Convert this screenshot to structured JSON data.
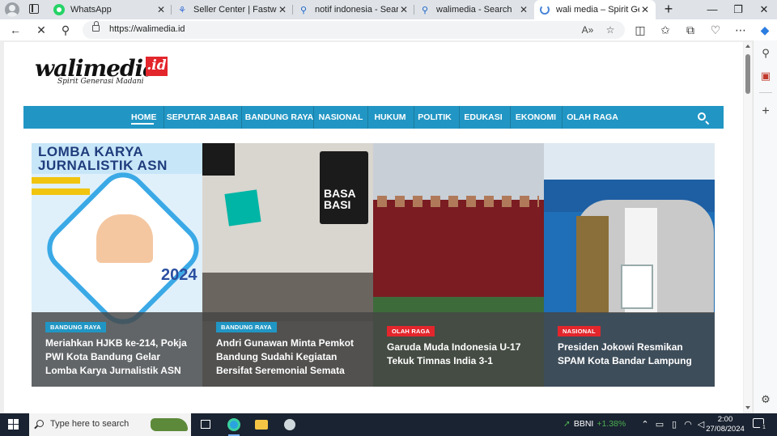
{
  "browser": {
    "tabs": [
      {
        "title": "WhatsApp",
        "icon": "whatsapp-icon",
        "close": "✕"
      },
      {
        "title": "Seller Center | Fastwork.id",
        "icon": "fastwork-icon",
        "close": "✕"
      },
      {
        "title": "notif indonesia - Search",
        "icon": "search-icon",
        "close": "✕"
      },
      {
        "title": "walimedia - Search",
        "icon": "search-icon",
        "close": "✕"
      },
      {
        "title": "wali media – Spirit Generasi Madani",
        "icon": "loading-spinner-icon",
        "close": "✕",
        "active": true
      }
    ],
    "new_tab": "+",
    "window_controls": {
      "minimize": "—",
      "maximize": "❐",
      "close": "✕"
    },
    "address_bar": {
      "url": "https://walimedia.id"
    },
    "toolbar_icons": [
      "back-icon",
      "stop-loading-icon",
      "search-icon",
      "read-aloud-icon",
      "favorite-star-icon",
      "split-screen-icon",
      "favorites-icon",
      "collections-icon",
      "browser-essentials-icon",
      "more-icon",
      "copilot-icon"
    ]
  },
  "site": {
    "logo": {
      "word": "walimedia",
      "suffix": ".id",
      "tagline": "Spirit Generasi Madani"
    },
    "nav": {
      "items": [
        "HOME",
        "SEPUTAR JABAR",
        "BANDUNG RAYA",
        "NASIONAL",
        "HUKUM",
        "POLITIK",
        "EDUKASI",
        "EKONOMI",
        "OLAH RAGA"
      ],
      "active": "HOME"
    },
    "cards": [
      {
        "badge": "BANDUNG RAYA",
        "badge_color": "#2196c4",
        "title": "Meriahkan HJKB ke-214, Pokja PWI Kota Bandung Gelar Lomba Karya Jurnalistik ASN",
        "image_text": "LOMBA KARYA JURNALISTIK ASN",
        "image_year": "2024"
      },
      {
        "badge": "BANDUNG RAYA",
        "badge_color": "#2196c4",
        "title": "Andri Gunawan Minta Pemkot Bandung Sudahi Kegiatan Bersifat Seremonial Semata",
        "image_text": "BASA BASI"
      },
      {
        "badge": "OLAH RAGA",
        "badge_color": "#e3262c",
        "title": "Garuda Muda Indonesia U-17 Tekuk Timnas India 3-1"
      },
      {
        "badge": "NASIONAL",
        "badge_color": "#e3262c",
        "title": "Presiden Jokowi Resmikan SPAM Kota Bandar Lampung"
      }
    ]
  },
  "taskbar": {
    "search_placeholder": "Type here to search",
    "stock": {
      "name": "BBNI",
      "change": "+1.38%"
    },
    "time": "2:00",
    "date": "27/08/2024",
    "notification_count": "1"
  }
}
